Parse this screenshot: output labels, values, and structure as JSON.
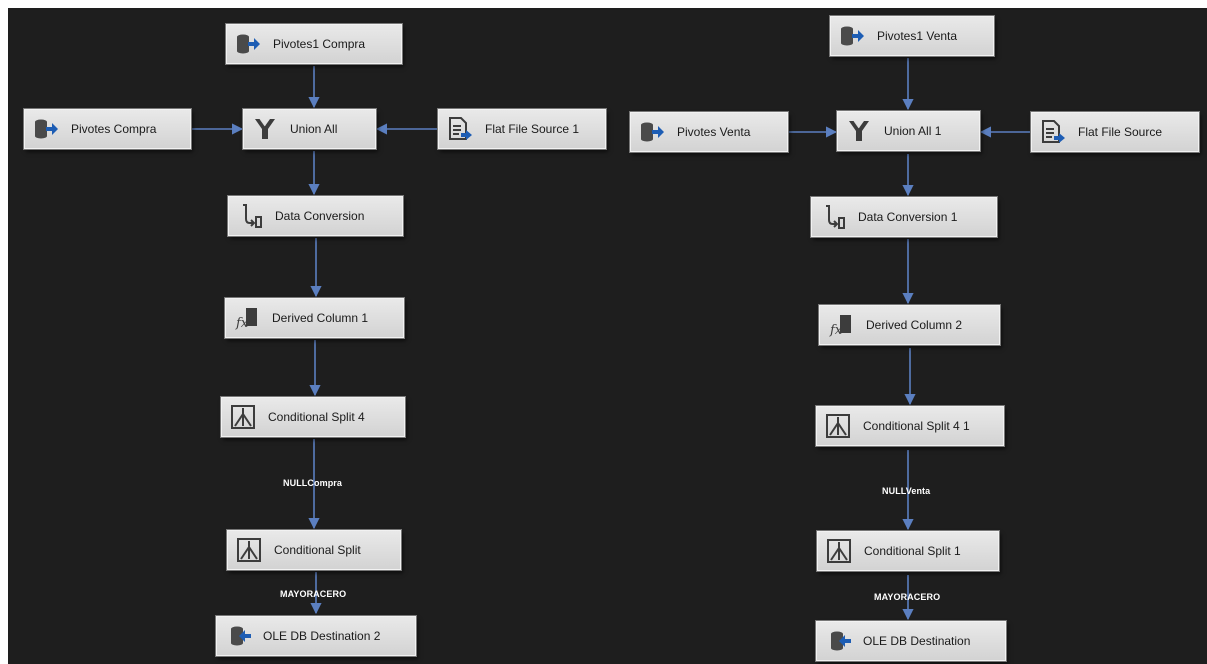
{
  "colors": {
    "canvas": "#1e1e1e",
    "connector": "#5b7fc0",
    "icon_blue": "#1d5db4"
  },
  "left_flow": {
    "nodes": {
      "pivotes1_compra": {
        "label": "Pivotes1 Compra",
        "icon": "db-source-icon"
      },
      "pivotes_compra": {
        "label": "Pivotes Compra",
        "icon": "db-source-icon"
      },
      "union_all": {
        "label": "Union All",
        "icon": "union-all-icon"
      },
      "flat_file_source_1": {
        "label": "Flat File Source 1",
        "icon": "flat-file-icon"
      },
      "data_conversion": {
        "label": "Data Conversion",
        "icon": "data-conversion-icon"
      },
      "derived_column_1": {
        "label": "Derived Column 1",
        "icon": "derived-column-icon"
      },
      "conditional_split_4": {
        "label": "Conditional Split 4",
        "icon": "conditional-split-icon"
      },
      "conditional_split": {
        "label": "Conditional Split",
        "icon": "conditional-split-icon"
      },
      "ole_db_destination_2": {
        "label": "OLE DB Destination 2",
        "icon": "db-destination-icon"
      }
    },
    "path_labels": {
      "null_compra": "NULLCompra",
      "mayoracero": "MAYORACERO"
    }
  },
  "right_flow": {
    "nodes": {
      "pivotes1_venta": {
        "label": "Pivotes1 Venta",
        "icon": "db-source-icon"
      },
      "pivotes_venta": {
        "label": "Pivotes Venta",
        "icon": "db-source-icon"
      },
      "union_all_1": {
        "label": "Union All 1",
        "icon": "union-all-icon"
      },
      "flat_file_source": {
        "label": "Flat File Source",
        "icon": "flat-file-icon"
      },
      "data_conversion_1": {
        "label": "Data Conversion 1",
        "icon": "data-conversion-icon"
      },
      "derived_column_2": {
        "label": "Derived Column 2",
        "icon": "derived-column-icon"
      },
      "conditional_split_4_1": {
        "label": "Conditional Split 4 1",
        "icon": "conditional-split-icon"
      },
      "conditional_split_1": {
        "label": "Conditional Split 1",
        "icon": "conditional-split-icon"
      },
      "ole_db_destination": {
        "label": "OLE DB Destination",
        "icon": "db-destination-icon"
      }
    },
    "path_labels": {
      "null_venta": "NULLVenta",
      "mayoracero": "MAYORACERO"
    }
  }
}
